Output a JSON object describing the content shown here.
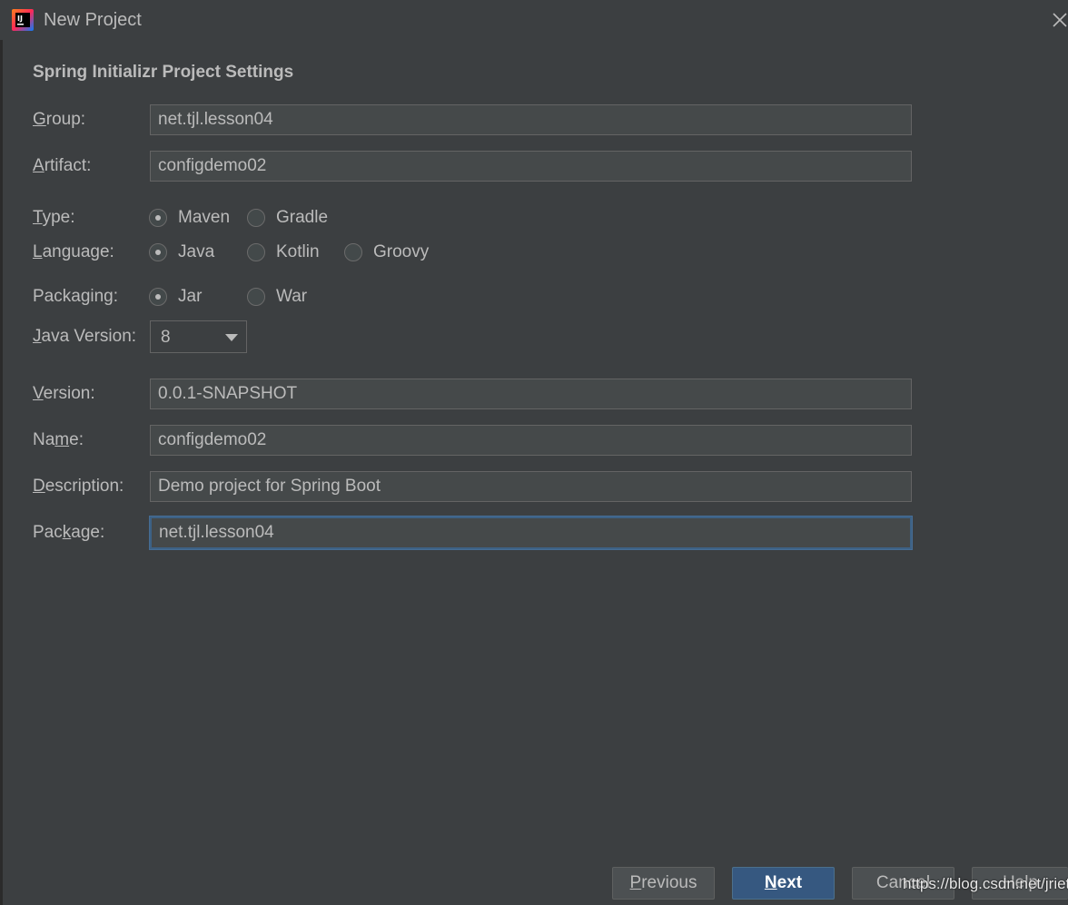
{
  "window": {
    "title": "New Project"
  },
  "section_title": "Spring Initializr Project Settings",
  "fields": {
    "group": {
      "label_pre": "",
      "label_u": "G",
      "label_post": "roup:",
      "value": "net.tjl.lesson04"
    },
    "artifact": {
      "label_pre": "",
      "label_u": "A",
      "label_post": "rtifact:",
      "value": "configdemo02"
    },
    "version": {
      "label_pre": "",
      "label_u": "V",
      "label_post": "ersion:",
      "value": "0.0.1-SNAPSHOT"
    },
    "name": {
      "label_pre": "Na",
      "label_u": "m",
      "label_post": "e:",
      "value": "configdemo02"
    },
    "description": {
      "label_pre": "",
      "label_u": "D",
      "label_post": "escription:",
      "value": "Demo project for Spring Boot"
    },
    "package": {
      "label_pre": "Pac",
      "label_u": "k",
      "label_post": "age:",
      "value": "net.tjl.lesson04"
    }
  },
  "type": {
    "label_pre": "",
    "label_u": "T",
    "label_post": "ype:",
    "options": [
      "Maven",
      "Gradle"
    ],
    "selected": "Maven"
  },
  "language": {
    "label_pre": "",
    "label_u": "L",
    "label_post": "anguage:",
    "options": [
      "Java",
      "Kotlin",
      "Groovy"
    ],
    "selected": "Java"
  },
  "packaging": {
    "label_pre": "Packa",
    "label_u": "g",
    "label_post": "ing:",
    "options": [
      "Jar",
      "War"
    ],
    "selected": "Jar"
  },
  "java_version": {
    "label_pre": "",
    "label_u": "J",
    "label_post": "ava Version:",
    "value": "8"
  },
  "buttons": {
    "previous": {
      "u": "P",
      "rest": "revious"
    },
    "next": {
      "u": "N",
      "rest": "ext"
    },
    "cancel": "Cancel",
    "help": "Help"
  },
  "watermark": "https://blog.csdn.net/jriet",
  "colors": {
    "background": "#3c3f41",
    "field_bg": "#45494a",
    "accent": "#365880",
    "focus": "#3d6185",
    "text": "#bbbbbb"
  }
}
